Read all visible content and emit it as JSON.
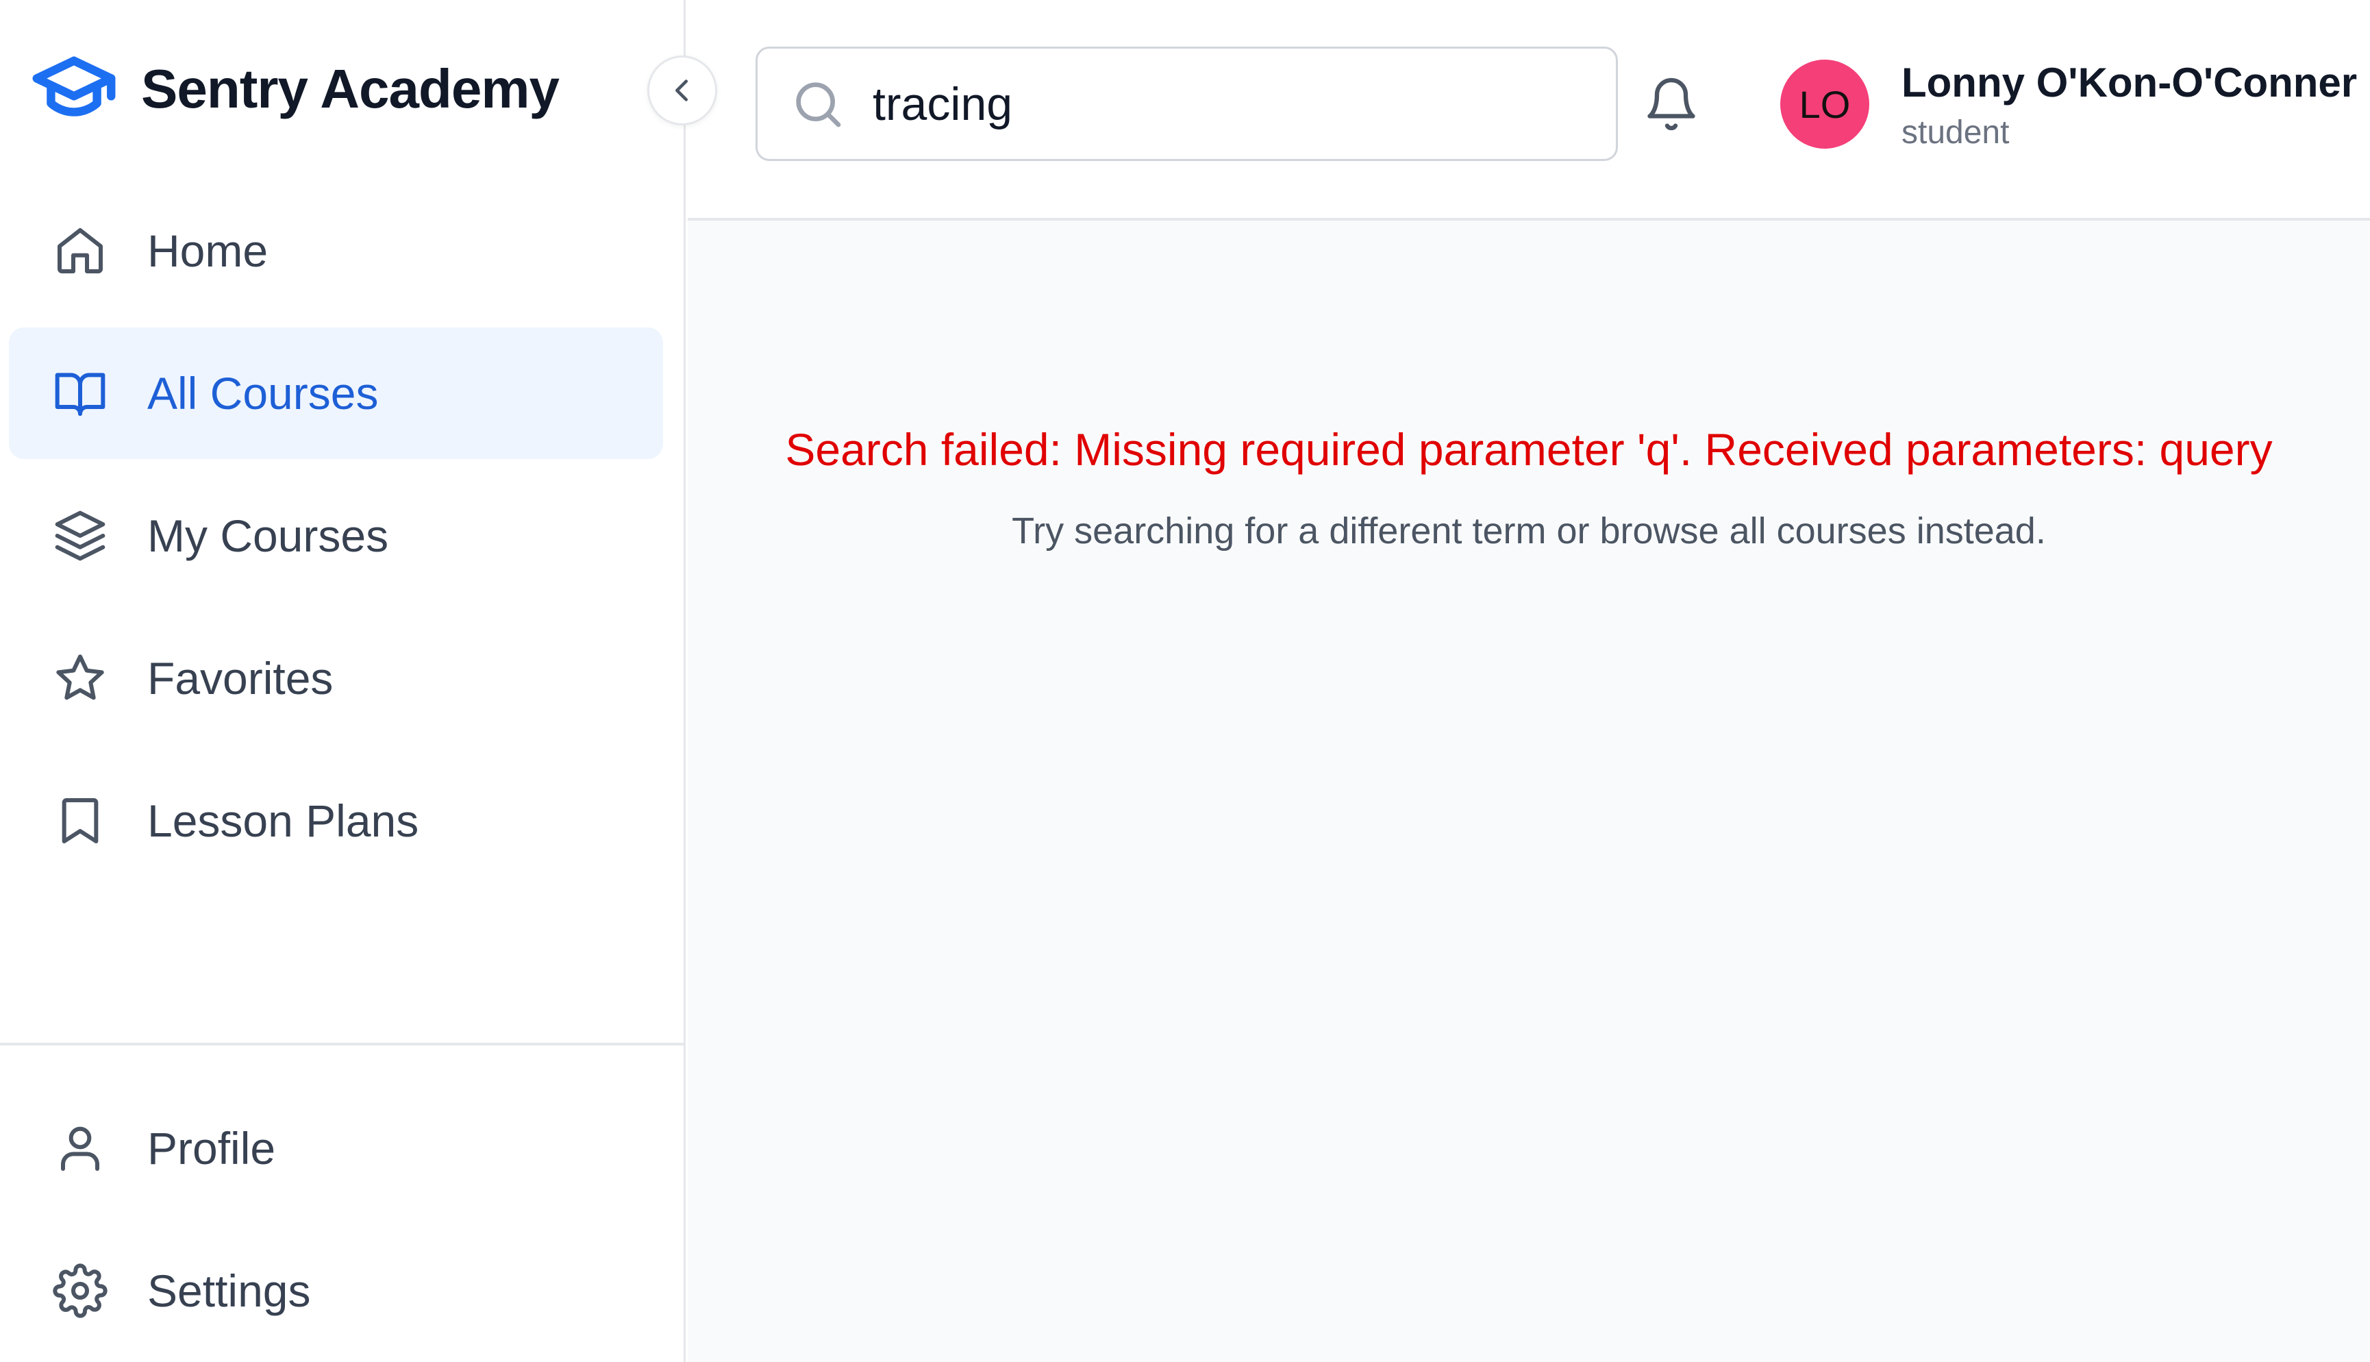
{
  "app": {
    "name": "Sentry Academy",
    "accent_color": "#1d5fd6",
    "error_color": "#e00000"
  },
  "sidebar": {
    "logo_icon": "graduation-cap-icon",
    "collapse_icon": "chevron-left-icon",
    "items": [
      {
        "label": "Home",
        "icon": "home-icon",
        "active": false
      },
      {
        "label": "All Courses",
        "icon": "book-open-icon",
        "active": true
      },
      {
        "label": "My Courses",
        "icon": "layers-icon",
        "active": false
      },
      {
        "label": "Favorites",
        "icon": "star-icon",
        "active": false
      },
      {
        "label": "Lesson Plans",
        "icon": "bookmark-icon",
        "active": false
      }
    ],
    "bottom_items": [
      {
        "label": "Profile",
        "icon": "user-icon"
      },
      {
        "label": "Settings",
        "icon": "settings-icon"
      }
    ]
  },
  "header": {
    "search": {
      "value": "tracing",
      "placeholder": "",
      "icon": "search-icon"
    },
    "notifications_icon": "bell-icon",
    "user": {
      "initials": "LO",
      "name": "Lonny O'Kon-O'Conner",
      "role": "student",
      "avatar_color": "#f43f78"
    }
  },
  "main": {
    "error": "Search failed: Missing required parameter 'q'. Received parameters: query",
    "hint": "Try searching for a different term or browse all courses instead."
  }
}
